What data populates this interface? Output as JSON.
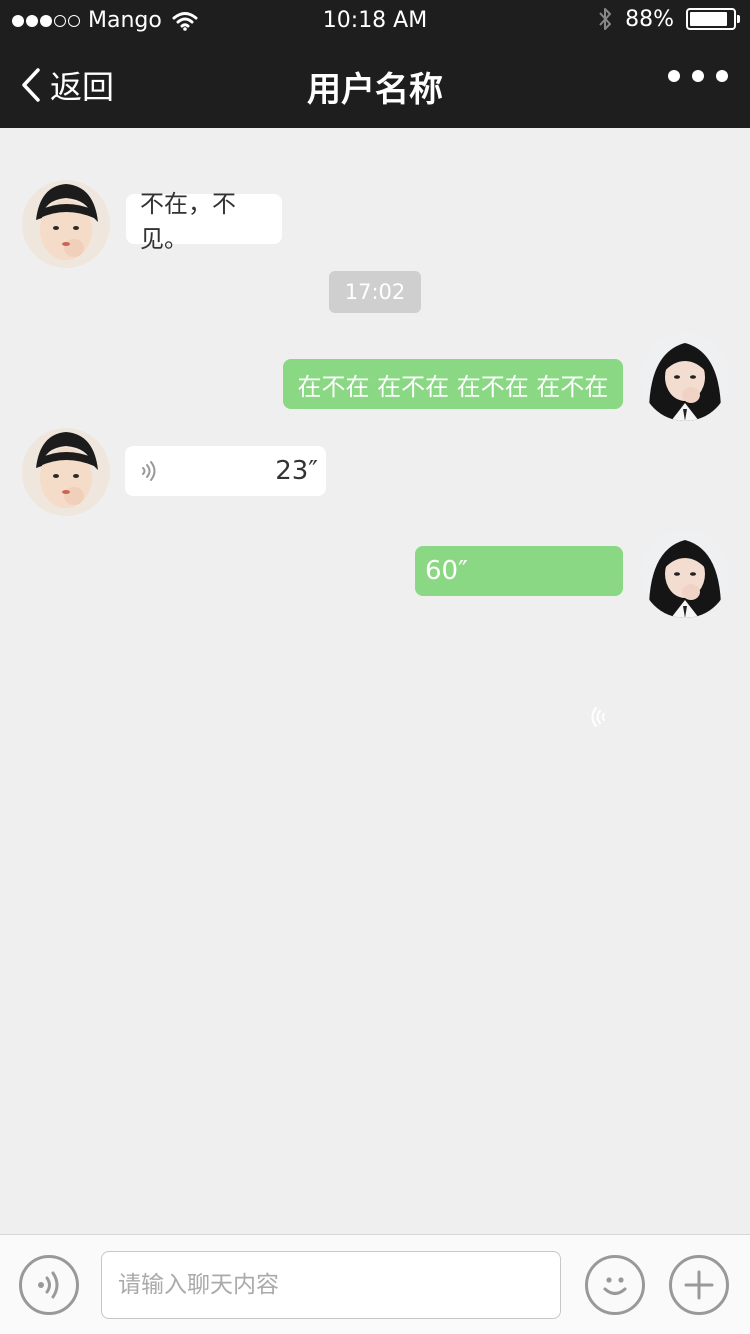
{
  "status": {
    "carrier": "Mango",
    "time": "10:18 AM",
    "battery": "88%",
    "battery_level": 0.88,
    "signal_dots_filled": 3,
    "signal_dots_total": 5
  },
  "nav": {
    "back_label": "返回",
    "title": "用户名称"
  },
  "messages": [
    {
      "side": "left",
      "type": "text",
      "text": "不在，不见。"
    },
    {
      "side": "center",
      "type": "timestamp",
      "text": "17:02"
    },
    {
      "side": "right",
      "type": "text",
      "text": "在不在 在不在 在不在 在不在"
    },
    {
      "side": "left",
      "type": "voice",
      "duration": "23″"
    },
    {
      "side": "right",
      "type": "voice",
      "duration": "60″"
    }
  ],
  "input": {
    "placeholder": "请输入聊天内容"
  },
  "colors": {
    "nav_bg": "#1e1e1e",
    "chat_bg": "#efefef",
    "bubble_green": "#8ad884",
    "bubble_white": "#ffffff",
    "timestamp_bg": "#cfcfcf"
  },
  "icons": {
    "back": "chevron-left-icon",
    "more": "more-dots-icon",
    "voice_mode": "voice-icon",
    "emoji": "smiley-icon",
    "add": "plus-icon"
  }
}
